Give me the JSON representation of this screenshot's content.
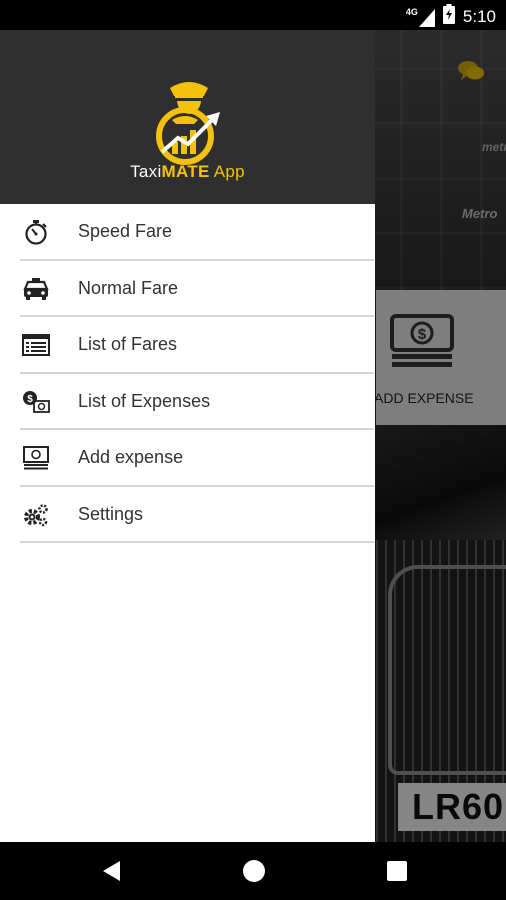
{
  "status_bar": {
    "network_label": "4G",
    "time": "5:10"
  },
  "drawer": {
    "app_title_part1": "Taxi",
    "app_title_part2": "MATE",
    "app_title_part3": " App",
    "items": [
      {
        "label": "Speed Fare",
        "icon": "stopwatch-icon"
      },
      {
        "label": "Normal Fare",
        "icon": "taxi-icon"
      },
      {
        "label": "List of Fares",
        "icon": "list-icon"
      },
      {
        "label": "List of Expenses",
        "icon": "coins-bill-icon"
      },
      {
        "label": "Add expense",
        "icon": "banknote-icon"
      },
      {
        "label": "Settings",
        "icon": "gears-icon"
      }
    ]
  },
  "background": {
    "sign_top": "metr",
    "sign_mid": "Metro",
    "tile_label": "ADD EXPENSE",
    "plate": "LR60"
  },
  "colors": {
    "accent": "#f4c20d",
    "header_bg": "#2f2f2f"
  }
}
